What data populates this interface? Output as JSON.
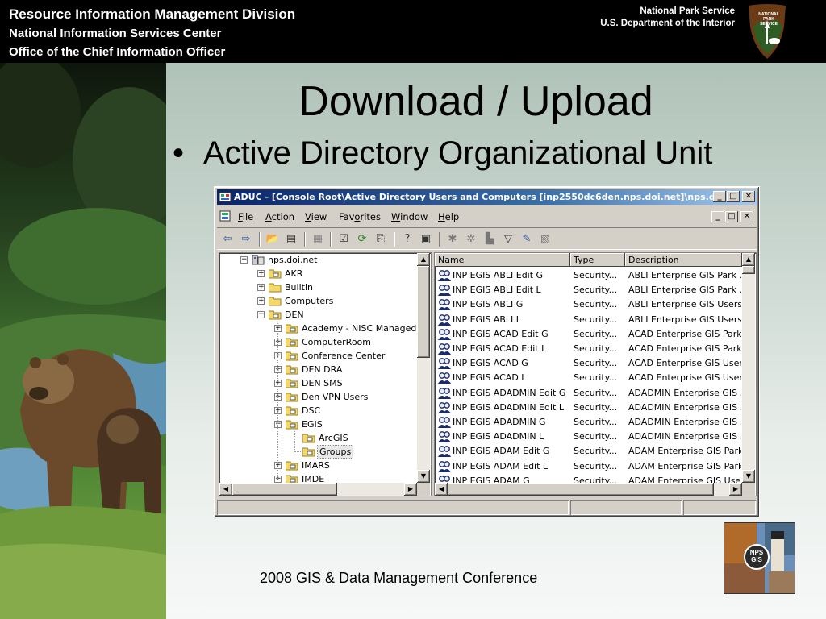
{
  "header": {
    "line1": "Resource Information Management Division",
    "line2": "National Information Services Center",
    "line3": "Office of the Chief Information Officer",
    "agency": "National Park Service",
    "department": "U.S. Department of the Interior",
    "logo_text": [
      "NATIONAL",
      "PARK",
      "SERVICE"
    ]
  },
  "slide": {
    "title": "Download / Upload",
    "bullet": "Active Directory Organizational Unit",
    "footer": "2008 GIS & Data Management Conference",
    "gis_logo_text": [
      "NPS",
      "GIS"
    ]
  },
  "window": {
    "title": "ADUC - [Console Root\\Active Directory Users and Computers [inp2550dc6den.nps.doi.net]\\nps.d...",
    "controls": {
      "minimize": "_",
      "restore": "□",
      "close": "✕"
    },
    "menu": [
      {
        "pre": "",
        "key": "F",
        "post": "ile"
      },
      {
        "pre": "",
        "key": "A",
        "post": "ction"
      },
      {
        "pre": "",
        "key": "V",
        "post": "iew"
      },
      {
        "pre": "Fav",
        "key": "o",
        "post": "rites"
      },
      {
        "pre": "",
        "key": "W",
        "post": "indow"
      },
      {
        "pre": "",
        "key": "H",
        "post": "elp"
      }
    ],
    "tree": [
      {
        "label": "nps.doi.net",
        "indent": 0,
        "expander": "−",
        "icon": "domain-icon"
      },
      {
        "label": "AKR",
        "indent": 1,
        "expander": "+",
        "icon": "ou-folder-icon"
      },
      {
        "label": "Builtin",
        "indent": 1,
        "expander": "+",
        "icon": "folder-icon"
      },
      {
        "label": "Computers",
        "indent": 1,
        "expander": "+",
        "icon": "folder-icon"
      },
      {
        "label": "DEN",
        "indent": 1,
        "expander": "−",
        "icon": "ou-folder-icon"
      },
      {
        "label": "Academy - NISC Managed",
        "indent": 2,
        "expander": "+",
        "icon": "ou-folder-icon"
      },
      {
        "label": "ComputerRoom",
        "indent": 2,
        "expander": "+",
        "icon": "ou-folder-icon"
      },
      {
        "label": "Conference Center",
        "indent": 2,
        "expander": "+",
        "icon": "ou-folder-icon"
      },
      {
        "label": "DEN DRA",
        "indent": 2,
        "expander": "+",
        "icon": "ou-folder-icon"
      },
      {
        "label": "DEN SMS",
        "indent": 2,
        "expander": "+",
        "icon": "ou-folder-icon"
      },
      {
        "label": "Den VPN Users",
        "indent": 2,
        "expander": "+",
        "icon": "ou-folder-icon"
      },
      {
        "label": "DSC",
        "indent": 2,
        "expander": "+",
        "icon": "ou-folder-icon"
      },
      {
        "label": "EGIS",
        "indent": 2,
        "expander": "−",
        "icon": "ou-folder-icon"
      },
      {
        "label": "ArcGIS",
        "indent": 3,
        "expander": "",
        "icon": "ou-folder-icon"
      },
      {
        "label": "Groups",
        "indent": 3,
        "expander": "",
        "icon": "ou-folder-icon",
        "selected": true
      },
      {
        "label": "IMARS",
        "indent": 2,
        "expander": "+",
        "icon": "ou-folder-icon"
      },
      {
        "label": "IMDE",
        "indent": 2,
        "expander": "+",
        "icon": "ou-folder-icon"
      }
    ],
    "columns": [
      "Name",
      "Type",
      "Description"
    ],
    "rows": [
      {
        "name": "INP EGIS ABLI Edit G",
        "type": "Security...",
        "desc": "ABLI Enterprise GIS Park ..."
      },
      {
        "name": "INP EGIS ABLI Edit L",
        "type": "Security...",
        "desc": "ABLI Enterprise GIS Park ..."
      },
      {
        "name": "INP EGIS ABLI G",
        "type": "Security...",
        "desc": "ABLI Enterprise GIS Users"
      },
      {
        "name": "INP EGIS ABLI L",
        "type": "Security...",
        "desc": "ABLI Enterprise GIS Users."
      },
      {
        "name": "INP EGIS ACAD Edit G",
        "type": "Security...",
        "desc": "ACAD Enterprise GIS Park."
      },
      {
        "name": "INP EGIS ACAD Edit L",
        "type": "Security...",
        "desc": "ACAD Enterprise GIS Park."
      },
      {
        "name": "INP EGIS ACAD G",
        "type": "Security...",
        "desc": "ACAD Enterprise GIS Users"
      },
      {
        "name": "INP EGIS ACAD L",
        "type": "Security...",
        "desc": "ACAD Enterprise GIS User."
      },
      {
        "name": "INP EGIS ADADMIN Edit G",
        "type": "Security...",
        "desc": "ADADMIN Enterprise GIS ..."
      },
      {
        "name": "INP EGIS ADADMIN Edit L",
        "type": "Security...",
        "desc": "ADADMIN Enterprise GIS ..."
      },
      {
        "name": "INP EGIS ADADMIN G",
        "type": "Security...",
        "desc": "ADADMIN Enterprise GIS ..."
      },
      {
        "name": "INP EGIS ADADMIN L",
        "type": "Security...",
        "desc": "ADADMIN Enterprise GIS ..."
      },
      {
        "name": "INP EGIS ADAM Edit G",
        "type": "Security...",
        "desc": "ADAM Enterprise GIS Park."
      },
      {
        "name": "INP EGIS ADAM Edit L",
        "type": "Security...",
        "desc": "ADAM Enterprise GIS Park."
      },
      {
        "name": "INP EGIS ADAM G",
        "type": "Security...",
        "desc": "ADAM Enterprise GIS Users"
      }
    ]
  },
  "colors": {
    "header_bg": "#000000",
    "titlebar_start": "#0a246a",
    "titlebar_end": "#a6caf0",
    "window_face": "#d4d0c8"
  }
}
